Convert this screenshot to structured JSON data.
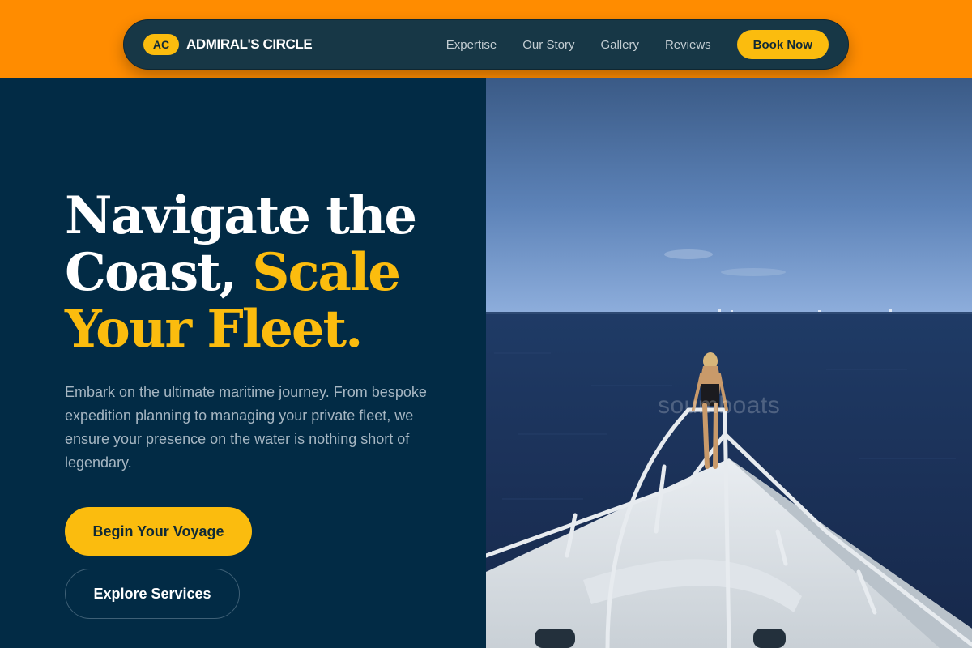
{
  "brand": {
    "badge": "AC",
    "name": "ADMIRAL'S CIRCLE"
  },
  "nav": {
    "links": [
      "Expertise",
      "Our Story",
      "Gallery",
      "Reviews"
    ],
    "cta": "Book Now"
  },
  "hero": {
    "headline_line1": "Navigate the",
    "headline_line2_white": "Coast,",
    "headline_line2_gold": "Scale",
    "headline_line3": "Your Fleet.",
    "description": "Embark on the ultimate maritime journey. From bespoke expedition planning to managing your private fleet, we ensure your presence on the water is nothing short of legendary.",
    "primary_button": "Begin Your Voyage",
    "secondary_button": "Explore Services"
  },
  "photo": {
    "watermark": "soumboats"
  },
  "colors": {
    "accent": "#fbbc0e",
    "band": "#ff8c00",
    "navy": "#022b45",
    "nav_bg": "#173746"
  }
}
